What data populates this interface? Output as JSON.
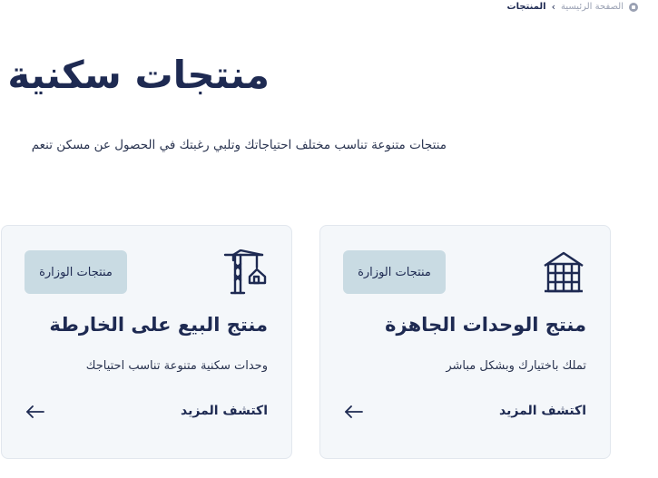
{
  "breadcrumb": {
    "home": "الصفحة الرئيسية",
    "separator": "›",
    "current": "المنتجات"
  },
  "page": {
    "title": "منتجات سكنية",
    "description": "منتجات متنوعة تناسب مختلف احتياجاتك وتلبي رغبتك في الحصول عن مسكن تنعم"
  },
  "cards": [
    {
      "badge": "منتجات الوزارة",
      "title": "منتج الوحدات الجاهزة",
      "text": "تملك باختيارك وبشكل مباشر",
      "link": "اكتشف المزيد",
      "icon": "building-icon"
    },
    {
      "badge": "منتجات الوزارة",
      "title": "منتج البيع على الخارطة",
      "text": "وحدات سكنية متنوعة تناسب احتياجك",
      "link": "اكتشف المزيد",
      "icon": "crane-icon"
    }
  ],
  "colors": {
    "primary": "#1e2a52",
    "card_bg": "#f4f7fa",
    "badge_bg": "#c9dbe3",
    "muted": "#9aa1b3"
  }
}
